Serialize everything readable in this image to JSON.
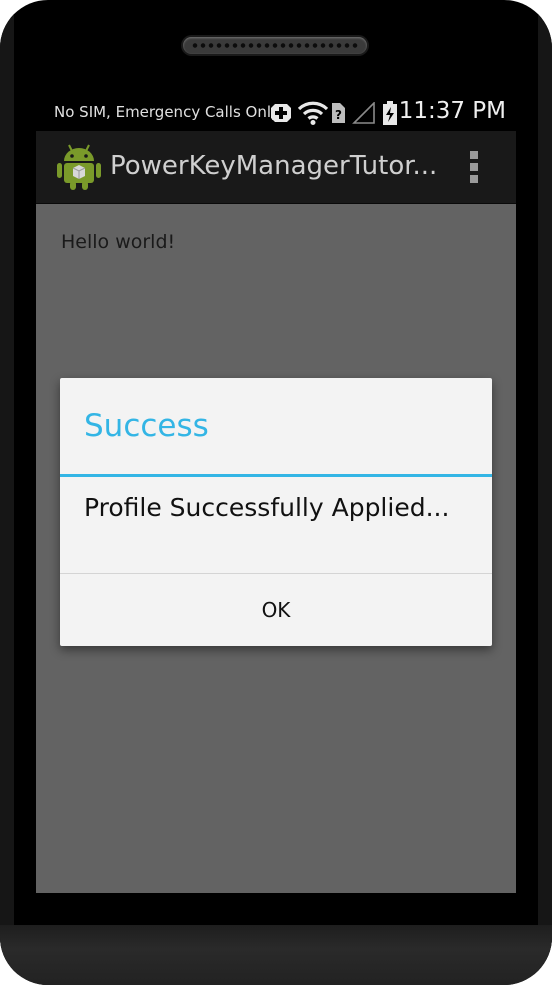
{
  "status_bar": {
    "carrier_text": "No SIM, Emergency Calls Only",
    "time": "11:37 PM",
    "icons": [
      "usb-debug-icon",
      "wifi-icon",
      "no-sim-icon",
      "signal-icon",
      "battery-charging-icon"
    ]
  },
  "action_bar": {
    "app_title": "PowerKeyManagerTutor...",
    "app_icon": "android-robot-icon",
    "overflow_icon": "overflow-menu-icon"
  },
  "content": {
    "text": "Hello world!"
  },
  "dialog": {
    "title": "Success",
    "message": "Profile Successfully Applied...",
    "button_label": "OK"
  },
  "colors": {
    "accent": "#33b5e5",
    "screen_dim": "#636363",
    "action_bar": "#191919",
    "dialog_bg": "#f3f3f3"
  }
}
